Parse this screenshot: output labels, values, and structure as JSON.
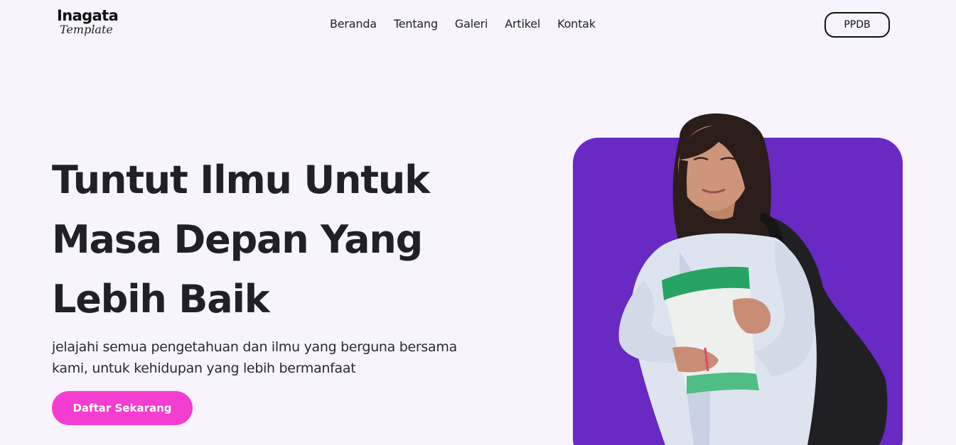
{
  "header": {
    "logo": {
      "main": "Inagata",
      "sub": "Template"
    },
    "nav": [
      {
        "label": "Beranda"
      },
      {
        "label": "Tentang"
      },
      {
        "label": "Galeri"
      },
      {
        "label": "Artikel"
      },
      {
        "label": "Kontak"
      }
    ],
    "cta_label": "PPDB"
  },
  "hero": {
    "title_lines": [
      "Tuntut Ilmu Untuk",
      "Masa Depan Yang",
      "Lebih Baik"
    ],
    "subtitle_lines": [
      "jelajahi semua pengetahuan dan ilmu yang berguna bersama",
      "kami, untuk kehidupan yang lebih bermanfaat"
    ],
    "button_label": "Daftar Sekarang",
    "image_alt": "student-photo"
  },
  "colors": {
    "background": "#f7f4fd",
    "accent_purple": "#6929c3",
    "accent_pink": "#f43dd1",
    "text_dark": "#202127"
  }
}
